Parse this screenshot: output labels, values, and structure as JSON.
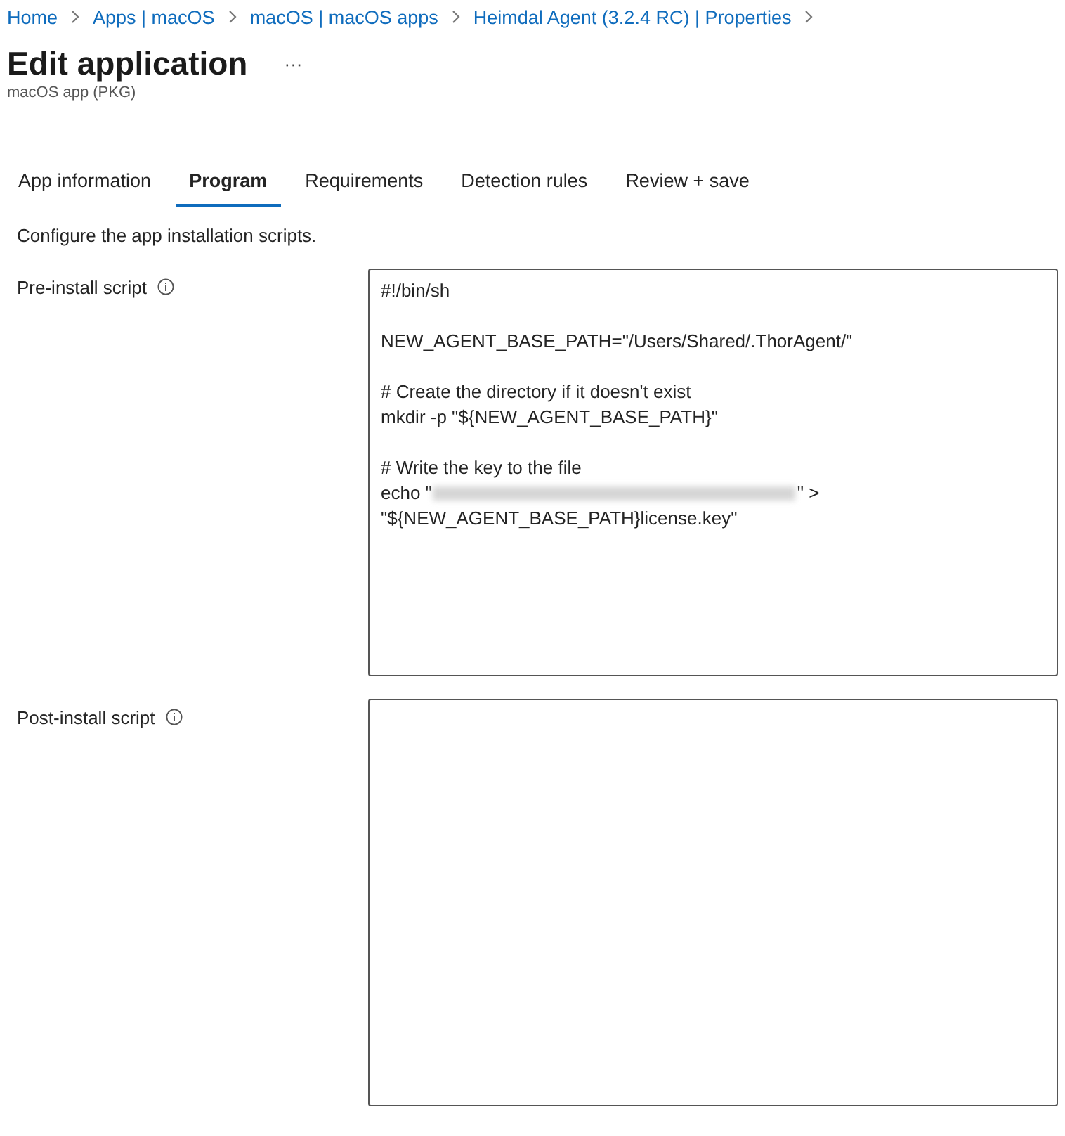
{
  "breadcrumb": [
    "Home",
    "Apps | macOS",
    "macOS | macOS apps",
    "Heimdal Agent (3.2.4 RC) | Properties"
  ],
  "header": {
    "title": "Edit application",
    "more": "···",
    "subtitle": "macOS app (PKG)"
  },
  "tabs": [
    {
      "label": "App information",
      "selected": false
    },
    {
      "label": "Program",
      "selected": true
    },
    {
      "label": "Requirements",
      "selected": false
    },
    {
      "label": "Detection rules",
      "selected": false
    },
    {
      "label": "Review + save",
      "selected": false
    }
  ],
  "description": "Configure the app installation scripts.",
  "fields": [
    {
      "label": "Pre-install script",
      "lines": [
        {
          "kind": "text",
          "text": "#!/bin/sh"
        },
        {
          "kind": "blank"
        },
        {
          "kind": "text",
          "text": "NEW_AGENT_BASE_PATH=\"/Users/Shared/.ThorAgent/\""
        },
        {
          "kind": "blank"
        },
        {
          "kind": "text",
          "text": "# Create the directory if it doesn't exist"
        },
        {
          "kind": "text",
          "text": "mkdir -p \"${NEW_AGENT_BASE_PATH}\""
        },
        {
          "kind": "blank"
        },
        {
          "kind": "text",
          "text": "# Write the key to the file"
        },
        {
          "kind": "redacted",
          "before": "echo \"",
          "after": "\" >"
        },
        {
          "kind": "text",
          "text": "\"${NEW_AGENT_BASE_PATH}license.key\""
        }
      ]
    },
    {
      "label": "Post-install script"
    }
  ]
}
